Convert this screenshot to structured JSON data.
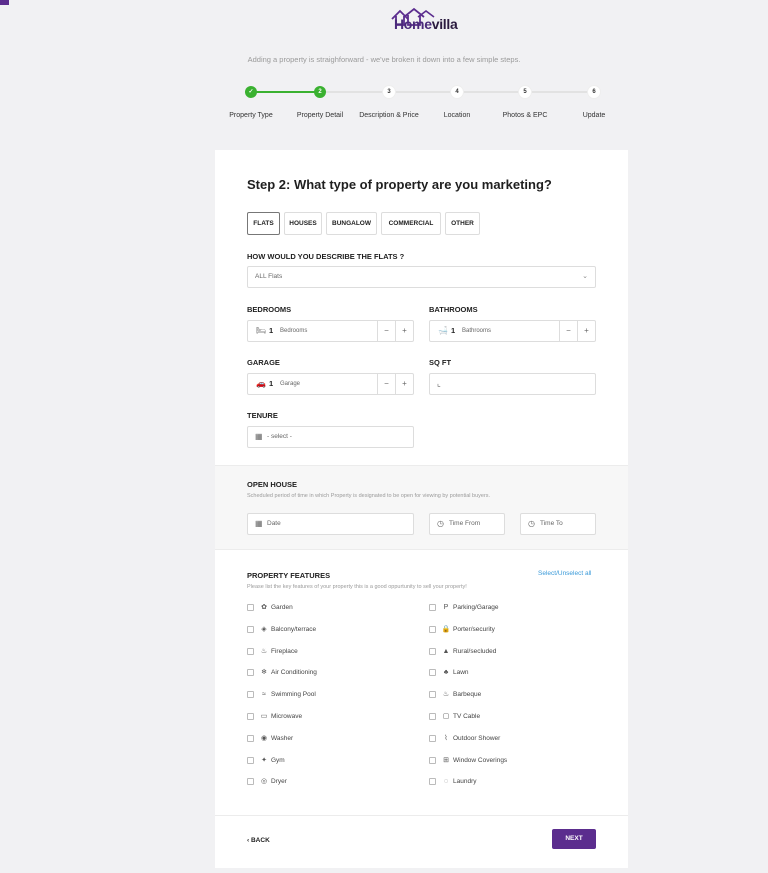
{
  "brand": {
    "name_part1": "Home",
    "name_part2": "villa"
  },
  "subtitle": "Adding a property is straighforward - we've broken it down into a few simple steps.",
  "steps": [
    {
      "num": "✓",
      "label": "Property Type",
      "state": "done"
    },
    {
      "num": "2",
      "label": "Property Detail",
      "state": "current"
    },
    {
      "num": "3",
      "label": "Description & Price",
      "state": "todo"
    },
    {
      "num": "4",
      "label": "Location",
      "state": "todo"
    },
    {
      "num": "5",
      "label": "Photos & EPC",
      "state": "todo"
    },
    {
      "num": "6",
      "label": "Update",
      "state": "todo"
    }
  ],
  "form": {
    "title": "Step 2: What type of property are you marketing?",
    "property_types": [
      "FLATS",
      "HOUSES",
      "BUNGALOW",
      "COMMERCIAL",
      "OTHER"
    ],
    "describe_label": "HOW WOULD YOU DESCRIBE THE FLATS ?",
    "describe_value": "ALL Flats",
    "bedrooms": {
      "label": "BEDROOMS",
      "value": "1",
      "unit": "Bedrooms"
    },
    "bathrooms": {
      "label": "BATHROOMS",
      "value": "1",
      "unit": "Bathrooms"
    },
    "garage": {
      "label": "GARAGE",
      "value": "1",
      "unit": "Garage"
    },
    "sqft": {
      "label": "SQ FT",
      "value": ""
    },
    "tenure": {
      "label": "TENURE",
      "value": "- select -"
    },
    "minus": "−",
    "plus": "+"
  },
  "open_house": {
    "title": "OPEN HOUSE",
    "description": "Scheduled period of time in which Property is designated to be open for viewing by potential buyers.",
    "date_placeholder": "Date",
    "time_from_placeholder": "Time From",
    "time_to_placeholder": "Time To"
  },
  "features": {
    "title": "PROPERTY FEATURES",
    "description": "Please list the key features of your property this is a good oppurtunity to sell your property!",
    "select_all": "Select/Unselect all",
    "left": [
      {
        "label": "Garden",
        "icon": "garden-icon"
      },
      {
        "label": "Balcony/terrace",
        "icon": "balcony-icon"
      },
      {
        "label": "Fireplace",
        "icon": "fireplace-icon"
      },
      {
        "label": "Air Conditioning",
        "icon": "air-conditioning-icon"
      },
      {
        "label": "Swimming Pool",
        "icon": "swimming-pool-icon"
      },
      {
        "label": "Microwave",
        "icon": "microwave-icon"
      },
      {
        "label": "Washer",
        "icon": "washer-icon"
      },
      {
        "label": "Gym",
        "icon": "gym-icon"
      },
      {
        "label": "Dryer",
        "icon": "dryer-icon"
      }
    ],
    "right": [
      {
        "label": "Parking/Garage",
        "icon": "parking-icon"
      },
      {
        "label": "Porter/security",
        "icon": "lock-icon"
      },
      {
        "label": "Rural/secluded",
        "icon": "rural-icon"
      },
      {
        "label": "Lawn",
        "icon": "lawn-icon"
      },
      {
        "label": "Barbeque",
        "icon": "barbeque-icon"
      },
      {
        "label": "TV Cable",
        "icon": "tv-icon"
      },
      {
        "label": "Outdoor Shower",
        "icon": "shower-icon"
      },
      {
        "label": "Window Coverings",
        "icon": "window-icon"
      },
      {
        "label": "Laundry",
        "icon": "laundry-icon"
      }
    ]
  },
  "nav": {
    "back": "BACK",
    "next": "NEXT"
  },
  "colors": {
    "brand": "#5b2d8e",
    "progress": "#3ab130",
    "link": "#3a9ad9"
  }
}
